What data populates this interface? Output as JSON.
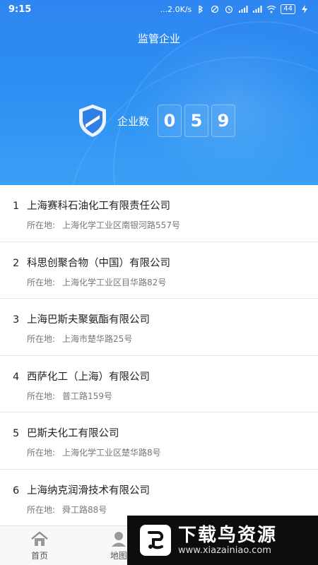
{
  "status_bar": {
    "time": "9:15",
    "network_speed": "...2.0K/s",
    "battery": "44"
  },
  "header": {
    "title": "监管企业"
  },
  "counter": {
    "label": "企业数",
    "digits": [
      "0",
      "5",
      "9"
    ]
  },
  "list": {
    "items": [
      {
        "index": "1",
        "name": "上海赛科石油化工有限责任公司",
        "address_label": "所在地:",
        "address": "上海化学工业区南银河路557号"
      },
      {
        "index": "2",
        "name": "科思创聚合物（中国）有限公司",
        "address_label": "所在地:",
        "address": "上海化学工业区目华路82号"
      },
      {
        "index": "3",
        "name": "上海巴斯夫聚氨酯有限公司",
        "address_label": "所在地:",
        "address": "上海市楚华路25号"
      },
      {
        "index": "4",
        "name": "西萨化工（上海）有限公司",
        "address_label": "所在地:",
        "address": "普工路159号"
      },
      {
        "index": "5",
        "name": "巴斯夫化工有限公司",
        "address_label": "所在地:",
        "address": "上海化学工业区楚华路8号"
      },
      {
        "index": "6",
        "name": "上海纳克润滑技术有限公司",
        "address_label": "所在地:",
        "address": "舜工路88号"
      }
    ]
  },
  "bottom_nav": {
    "home_label": "首页",
    "map_label": "地图"
  },
  "watermark": {
    "cn": "下载鸟资源",
    "en": "www.xiazainiao.com"
  },
  "colors": {
    "accent": "#2f86f0",
    "text": "#222222",
    "muted": "#777777"
  }
}
